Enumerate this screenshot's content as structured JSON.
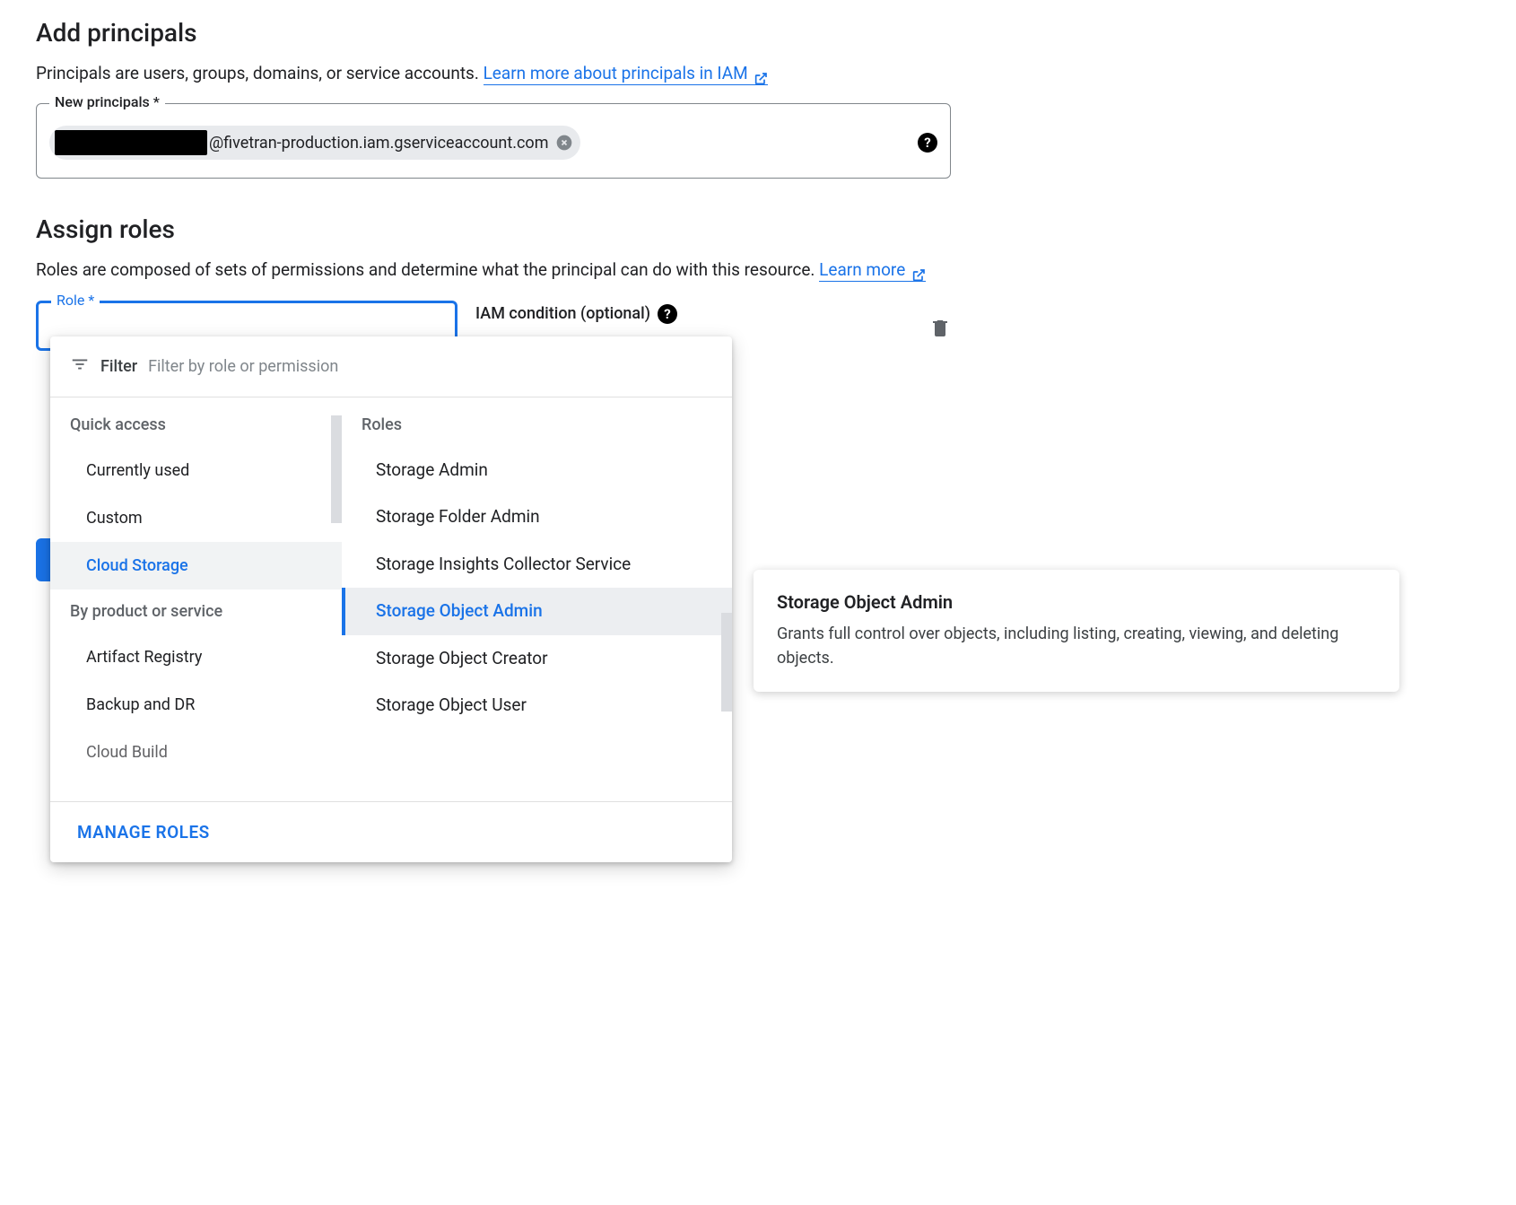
{
  "addPrincipals": {
    "heading": "Add principals",
    "description": "Principals are users, groups, domains, or service accounts. ",
    "learnMoreText": "Learn more about principals in IAM",
    "inputLabel": "New principals *",
    "chipText": "@fivetran-production.iam.gserviceaccount.com"
  },
  "assignRoles": {
    "heading": "Assign roles",
    "description": "Roles are composed of sets of permissions and determine what the principal can do with this resource. ",
    "learnMoreText": "Learn more",
    "roleLabel": "Role *",
    "iamConditionLabel": "IAM condition (optional)"
  },
  "dropdown": {
    "filterLabel": "Filter",
    "filterPlaceholder": "Filter by role or permission",
    "leftCol": {
      "quickAccessHeader": "Quick access",
      "items1": [
        "Currently used",
        "Custom",
        "Cloud Storage"
      ],
      "byProductHeader": "By product or service",
      "items2": [
        "Artifact Registry",
        "Backup and DR",
        "Cloud Build"
      ],
      "selected": "Cloud Storage"
    },
    "rightCol": {
      "header": "Roles",
      "items": [
        "Storage Admin",
        "Storage Folder Admin",
        "Storage Insights Collector Service",
        "Storage Object Admin",
        "Storage Object Creator",
        "Storage Object User"
      ],
      "selected": "Storage Object Admin"
    },
    "manageRoles": "MANAGE ROLES"
  },
  "tooltip": {
    "title": "Storage Object Admin",
    "description": "Grants full control over objects, including listing, creating, viewing, and deleting objects."
  }
}
